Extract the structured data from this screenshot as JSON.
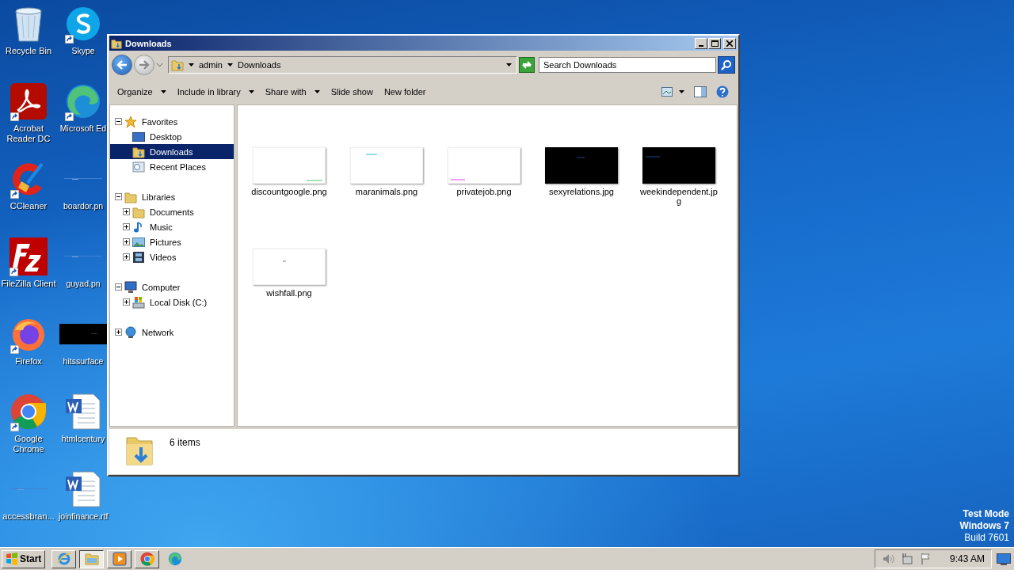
{
  "desktop": {
    "icons": [
      {
        "label": "Recycle Bin",
        "kind": "recycle",
        "shortcut": false
      },
      {
        "label": "Acrobat Reader DC",
        "kind": "acrobat",
        "shortcut": true
      },
      {
        "label": "CCleaner",
        "kind": "ccleaner",
        "shortcut": true
      },
      {
        "label": "FileZilla Client",
        "kind": "filezilla",
        "shortcut": true
      },
      {
        "label": "Firefox",
        "kind": "firefox",
        "shortcut": true
      },
      {
        "label": "Google Chrome",
        "kind": "chrome",
        "shortcut": true
      },
      {
        "label": "accessbran...",
        "kind": "image-light",
        "shortcut": false
      },
      {
        "label": "Skype",
        "kind": "skype",
        "shortcut": true
      },
      {
        "label": "Microsoft Ed",
        "kind": "edge",
        "shortcut": true
      },
      {
        "label": "boardor.pn",
        "kind": "image-light",
        "shortcut": false
      },
      {
        "label": "guyad.pn",
        "kind": "image-light",
        "shortcut": false
      },
      {
        "label": "hitssurface",
        "kind": "image-dark",
        "shortcut": false
      },
      {
        "label": "htmlcentury",
        "kind": "word",
        "shortcut": false
      },
      {
        "label": "joinfinance.rtf",
        "kind": "word",
        "shortcut": false
      }
    ],
    "test_mode": [
      "Test Mode",
      "Windows 7",
      "Build 7601"
    ]
  },
  "window": {
    "title": "Downloads",
    "address": {
      "crumbs": [
        "admin",
        "Downloads"
      ]
    },
    "search": {
      "placeholder": "Search Downloads"
    },
    "toolbar": [
      {
        "label": "Organize",
        "dropdown": true
      },
      {
        "label": "Include in library",
        "dropdown": true
      },
      {
        "label": "Share with",
        "dropdown": true
      },
      {
        "label": "Slide show",
        "dropdown": false
      },
      {
        "label": "New folder",
        "dropdown": false
      }
    ],
    "navigation": [
      {
        "label": "Favorites",
        "kind": "star",
        "expanded": true,
        "selected": false,
        "children": [
          {
            "label": "Desktop",
            "kind": "desktop",
            "selected": false
          },
          {
            "label": "Downloads",
            "kind": "downloads",
            "selected": true
          },
          {
            "label": "Recent Places",
            "kind": "recent",
            "selected": false
          }
        ]
      },
      {
        "label": "Libraries",
        "kind": "library",
        "expanded": true,
        "selected": false,
        "children": [
          {
            "label": "Documents",
            "kind": "documents",
            "expanded": false,
            "selected": false
          },
          {
            "label": "Music",
            "kind": "music",
            "expanded": false,
            "selected": false
          },
          {
            "label": "Pictures",
            "kind": "pictures",
            "expanded": false,
            "selected": false
          },
          {
            "label": "Videos",
            "kind": "videos",
            "expanded": false,
            "selected": false
          }
        ]
      },
      {
        "label": "Computer",
        "kind": "computer",
        "expanded": true,
        "selected": false,
        "children": [
          {
            "label": "Local Disk (C:)",
            "kind": "disk",
            "expanded": false,
            "selected": false
          }
        ]
      },
      {
        "label": "Network",
        "kind": "network",
        "expanded": false,
        "selected": false
      }
    ],
    "files": [
      {
        "name": "discountgoogle.png",
        "dark": false
      },
      {
        "name": "maranimals.png",
        "dark": false
      },
      {
        "name": "privatejob.png",
        "dark": false
      },
      {
        "name": "sexyrelations.jpg",
        "dark": true
      },
      {
        "name": "weekindependent.jpg",
        "dark": true
      },
      {
        "name": "wishfall.png",
        "dark": false
      }
    ],
    "status": {
      "count": "6 items"
    }
  },
  "taskbar": {
    "start": "Start",
    "apps": [
      {
        "kind": "ie",
        "selected": false
      },
      {
        "kind": "explorer",
        "selected": true
      },
      {
        "kind": "media",
        "selected": false
      },
      {
        "kind": "chrome",
        "selected": false
      },
      {
        "kind": "edge",
        "selected": false
      }
    ],
    "clock": "9:43 AM"
  }
}
